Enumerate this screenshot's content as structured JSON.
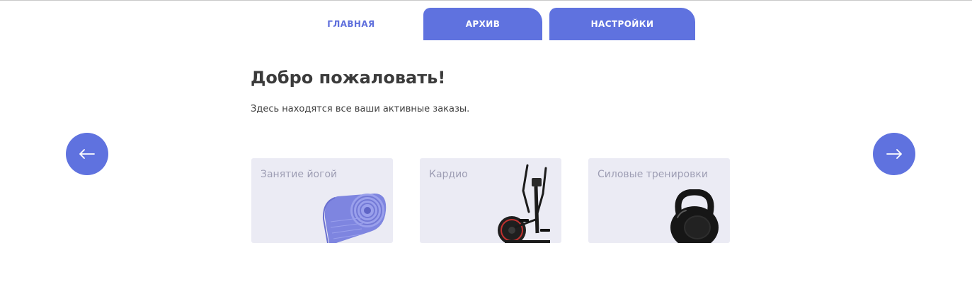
{
  "nav": {
    "tabs": [
      {
        "label": "ГЛАВНАЯ"
      },
      {
        "label": "АРХИВ"
      },
      {
        "label": "НАСТРОЙКИ"
      }
    ]
  },
  "main": {
    "title": "Добро пожаловать!",
    "subtitle": "Здесь находятся все ваши активные заказы."
  },
  "carousel": {
    "prev_icon": "arrow-left-icon",
    "next_icon": "arrow-right-icon",
    "cards": [
      {
        "label": "Занятие йогой",
        "image": "yoga-mat"
      },
      {
        "label": "Кардио",
        "image": "elliptical-trainer"
      },
      {
        "label": "Силовые тренировки",
        "image": "kettlebell"
      }
    ]
  },
  "colors": {
    "accent": "#5f72df",
    "card_bg": "#ebebf4",
    "card_text": "#9e9eb4",
    "title_text": "#3b3b3b"
  }
}
